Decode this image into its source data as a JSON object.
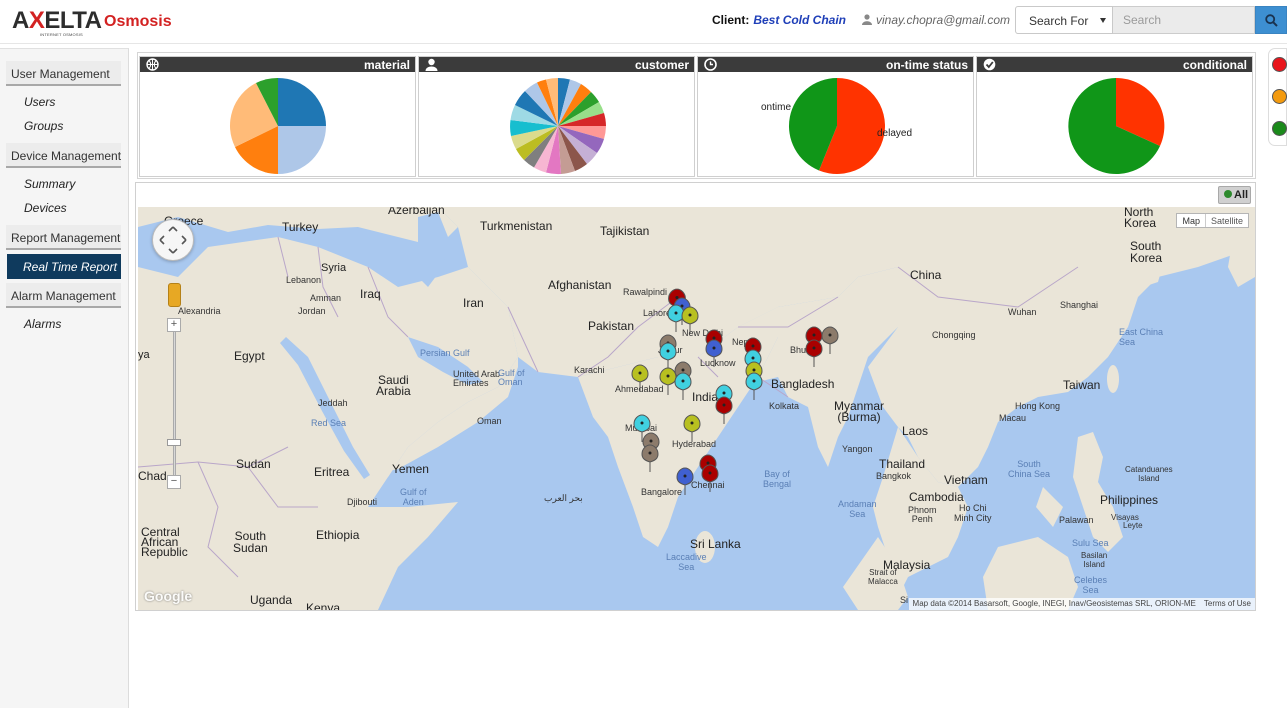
{
  "header": {
    "logo_text": "AXELTA",
    "logo_subtext": "INTERNET OSMOSIS",
    "app_name": "Osmosis",
    "client_label": "Client:",
    "client_value": "Best Cold Chain",
    "user_email": "vinay.chopra@gmail.com",
    "search_select": "Search For",
    "search_placeholder": "Search"
  },
  "sidebar": {
    "groups": [
      {
        "label": "User Management",
        "items": [
          "Users",
          "Groups"
        ]
      },
      {
        "label": "Device Management",
        "items": [
          "Summary",
          "Devices"
        ]
      },
      {
        "label": "Report Management",
        "items": [
          "Real Time Report"
        ],
        "active": "Real Time Report"
      },
      {
        "label": "Alarm Management",
        "items": [
          "Alarms"
        ]
      }
    ]
  },
  "panels": [
    {
      "title": "material",
      "icon": "globe-icon"
    },
    {
      "title": "customer",
      "icon": "person-icon"
    },
    {
      "title": "on-time status",
      "icon": "clock-icon",
      "labels": [
        "ontime",
        "delayed"
      ]
    },
    {
      "title": "conditional",
      "icon": "check-icon"
    }
  ],
  "status_dots": [
    {
      "color": "#e8141b"
    },
    {
      "color": "#f39a0e"
    },
    {
      "color": "#1b8a1b"
    }
  ],
  "map": {
    "all_button": "All",
    "map_types": [
      "Map",
      "Satellite"
    ],
    "logo": "Google",
    "attribution": "Map data ©2014 Basarsoft, Google, INEGI, Inav/Geosistemas SRL, ORION-ME",
    "terms": "Terms of Use",
    "labels": {
      "greece": "Greece",
      "azerbaijan": "Azerbaijan",
      "turkey": "Turkey",
      "turkmenistan": "Turkmenistan",
      "tajikistan": "Tajikistan",
      "north_korea": "North\nKorea",
      "south_korea": "South\nKorea",
      "china": "China",
      "syria": "Syria",
      "lebanon": "Lebanon",
      "amman": "Amman",
      "iraq": "Iraq",
      "iran": "Iran",
      "afghanistan": "Afghanistan",
      "rawalpindi": "Rawalpindi",
      "pakistan": "Pakistan",
      "lahore": "Lahore",
      "new_delhi": "New Delhi",
      "shanghai": "Shanghai",
      "alexandria": "Alexandria",
      "jordan": "Jordan",
      "wuhan": "Wuhan",
      "egypt": "Egypt",
      "ya": "ya",
      "persian_gulf": "Persian Gulf",
      "jaipur": "Jaipur",
      "lucknow": "Lucknow",
      "nepal": "Nep",
      "bhutan": "Bhuta",
      "chongqing": "Chongqing",
      "east_china_sea": "East China Sea",
      "saudi_arabia": "Saudi\nArabia",
      "karachi": "Karachi",
      "uae": "United Arab\nEmirates",
      "gulf_of_oman": "Gulf of\nOman",
      "ahmedabad": "Ahmedabad",
      "india": "India",
      "bangladesh": "Bangladesh",
      "taiwan": "Taiwan",
      "jeddah": "Jeddah",
      "kolkata": "Kolkata",
      "myanmar": "Myanmar\n(Burma)",
      "hong_kong": "Hong Kong",
      "red_sea": "Red Sea",
      "oman": "Oman",
      "mumbai": "Mumbai",
      "macau": "Macau",
      "laos": "Laos",
      "hyderabad": "Hyderabad",
      "sudan": "Sudan",
      "yemen": "Yemen",
      "eritrea": "Eritrea",
      "chad": "Chad",
      "yangon": "Yangon",
      "thailand": "Thailand",
      "bay_of_bengal": "Bay of\nBengal",
      "south_china_sea": "South\nChina Sea",
      "bangkok": "Bangkok",
      "vietnam": "Vietnam",
      "catanduanes": "Catanduanes\nIsland",
      "chennai": "Chennai",
      "gulf_of_aden": "Gulf of\nAden",
      "arabian_sea": "بحر العرب",
      "djibouti": "Djibouti",
      "bangalore": "Bangalore",
      "andaman_sea": "Andaman\nSea",
      "cambodia": "Cambodia",
      "philippines": "Philippines",
      "phnom_penh": "Phnom\nPenh",
      "ho_chi_minh": "Ho Chi\nMinh City",
      "palawan": "Palawan",
      "visayas": "Visayas",
      "leyte": "Leyte",
      "ethiopia": "Ethiopia",
      "south_sudan": "South\nSudan",
      "car": "Central\nAfrican\nRepublic",
      "sri_lanka": "Sri Lanka",
      "sulu_sea": "Sulu Sea",
      "laccadive_sea": "Laccadive\nSea",
      "basilan": "Basilan\nIsland",
      "malaysia": "Malaysia",
      "strait": "Strait of\nMalacca",
      "celebes": "Celebes\nSea",
      "uganda": "Uganda",
      "kenya": "Kenya",
      "singapore": "Si"
    }
  }
}
